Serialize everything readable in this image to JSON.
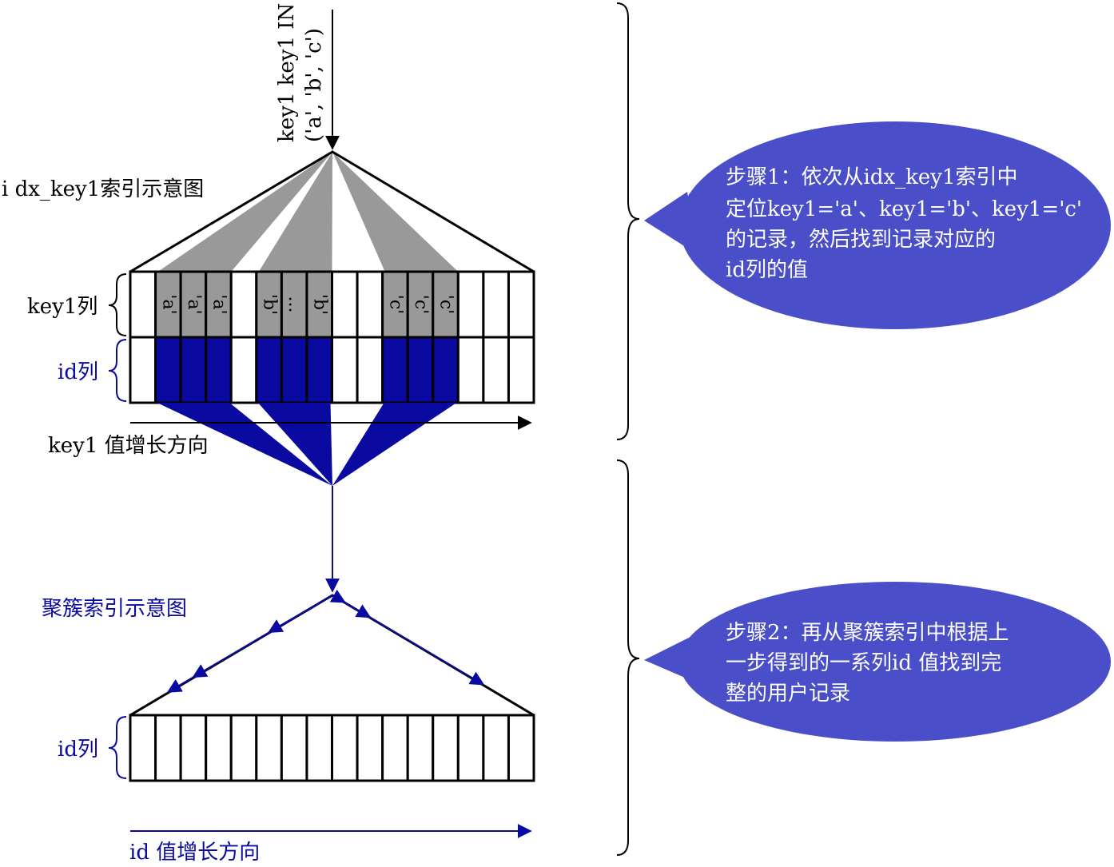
{
  "query": {
    "line1": "key1 key1 IN",
    "line2": "('a', 'b', 'c')"
  },
  "secondary_index": {
    "title": "i dx_key1索引示意图",
    "key_col_label": "key1列",
    "id_col_label": "id列",
    "direction_label": "key1 值增长方向",
    "cells": [
      "",
      "'a'",
      "'a'",
      "'a'",
      "",
      "'b'",
      "...",
      "'b'",
      "",
      "",
      "'c'",
      "'c'",
      "'c'",
      "",
      "",
      ""
    ],
    "highlighted": [
      false,
      true,
      true,
      true,
      false,
      true,
      true,
      true,
      false,
      false,
      true,
      true,
      true,
      false,
      false,
      false
    ]
  },
  "clustered_index": {
    "title": "聚簇索引示意图",
    "id_col_label": "id列",
    "direction_label": "id 值增长方向",
    "cell_count": 16,
    "pointer_targets": [
      1.5,
      2.5,
      5.5,
      8.5,
      9.5,
      14
    ]
  },
  "steps": [
    {
      "lines": [
        "步骤1：依次从idx_key1索引中",
        "定位key1='a'、key1='b'、key1='c'",
        "的记录，然后找到记录对应的",
        "id列的值"
      ]
    },
    {
      "lines": [
        "步骤2：再从聚簇索引中根据上",
        "一步得到的一系列id 值找到完",
        "整的用户记录"
      ]
    }
  ],
  "colors": {
    "blue": "#0a0aa0",
    "gray": "#999999",
    "bubble": "#4a4ec8",
    "line": "#000000"
  }
}
